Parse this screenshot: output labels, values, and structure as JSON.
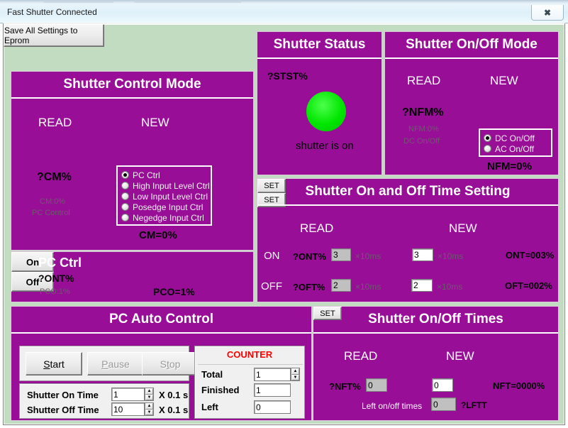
{
  "window": {
    "title": "Fast Shutter Connected",
    "close_label": "✖"
  },
  "toolbar": {
    "save_eprom_label": "Save All Settings to Eprom"
  },
  "shutter_control_mode": {
    "title": "Shutter Control Mode",
    "read_label": "READ",
    "new_label": "NEW",
    "read_query": "?CM%",
    "read_value": "CM:0%",
    "read_desc": "PC Control",
    "result": "CM=0%",
    "options": [
      {
        "label": "PC Ctrl",
        "selected": true
      },
      {
        "label": "High Input Level Ctrl",
        "selected": false
      },
      {
        "label": "Low Input Level Ctrl",
        "selected": false
      },
      {
        "label": "Posedge Input Ctrl",
        "selected": false
      },
      {
        "label": "Negedge Input Ctrl",
        "selected": false
      }
    ]
  },
  "pc_ctrl": {
    "title": "PC Ctrl",
    "query": "?ONT%",
    "read_value": "PCO:1%",
    "on_label": "On",
    "off_label": "Off",
    "result": "PCO=1%"
  },
  "shutter_status": {
    "title": "Shutter Status",
    "query": "?STST%",
    "led_color": "#00e600",
    "state_text": "shutter is on"
  },
  "shutter_onoff_mode": {
    "title": "Shutter On/Off Mode",
    "read_label": "READ",
    "new_label": "NEW",
    "read_query": "?NFM%",
    "read_value": "NFM:0%",
    "read_desc": "DC On/Off",
    "result": "NFM=0%",
    "options": [
      {
        "label": "DC On/Off",
        "selected": true
      },
      {
        "label": "AC On/Off",
        "selected": false
      }
    ]
  },
  "time_setting": {
    "title": "Shutter On and Off Time Setting",
    "read_label": "READ",
    "new_label": "NEW",
    "set_label": "SET",
    "unit": "×10ms",
    "rows": [
      {
        "row_label": "ON",
        "query": "?ONT%",
        "read_value": "3",
        "new_value": "3",
        "result": "ONT=003%"
      },
      {
        "row_label": "OFF",
        "query": "?OFT%",
        "read_value": "2",
        "new_value": "2",
        "result": "OFT=002%"
      }
    ]
  },
  "pc_auto_control": {
    "title": "PC Auto Control",
    "start_label": "Start",
    "pause_label": "Pause",
    "stop_label": "Stop",
    "on_time_label": "Shutter On Time",
    "on_time_value": "1",
    "on_time_unit": "X 0.1 s",
    "off_time_label": "Shutter Off Time",
    "off_time_value": "10",
    "off_time_unit": "X 0.1 s",
    "counter": {
      "title": "COUNTER",
      "title_color": "#ff0000",
      "total_label": "Total",
      "total_value": "1",
      "finished_label": "Finished",
      "finished_value": "1",
      "left_label": "Left",
      "left_value": "0"
    }
  },
  "shutter_onoff_times": {
    "title": "Shutter On/Off Times",
    "read_label": "READ",
    "new_label": "NEW",
    "query": "?NFT%",
    "read_value": "0",
    "new_value": "0",
    "set_label": "SET",
    "result": "NFT=0000%",
    "left_label": "Left on/off times",
    "left_value": "0",
    "left_query": "?LFTT"
  }
}
